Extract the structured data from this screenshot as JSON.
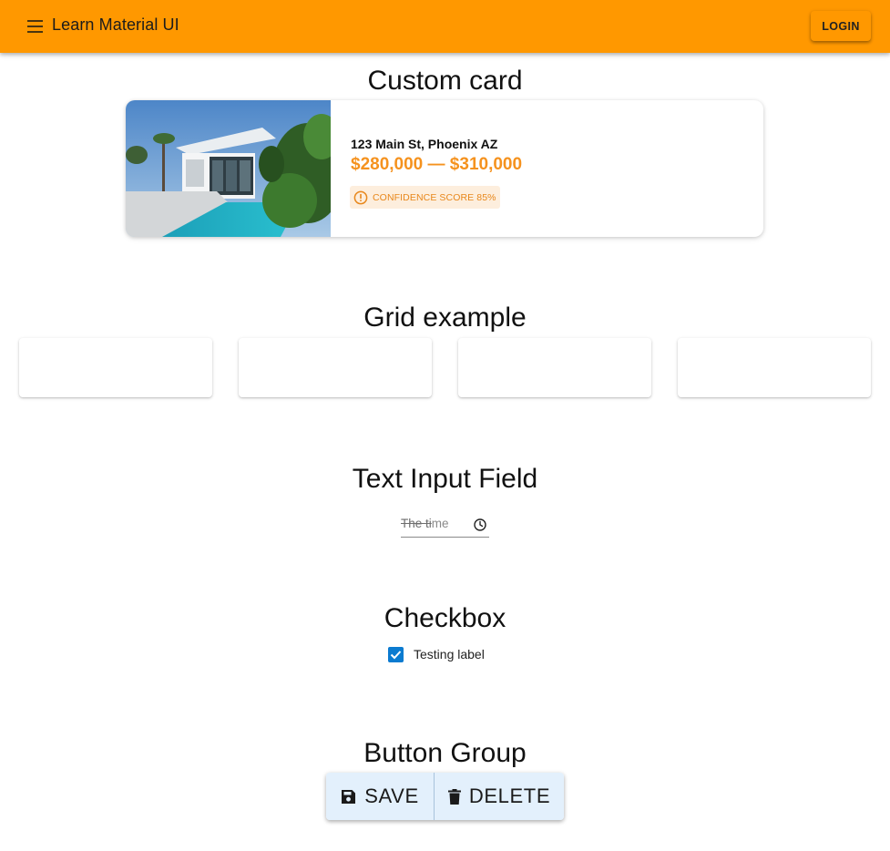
{
  "app_bar": {
    "title": "Learn Material UI",
    "menu_icon": "menu-icon",
    "login_label": "LOGIN",
    "color": "#ff9800"
  },
  "custom_card": {
    "heading": "Custom card",
    "image_icon": "house-photo",
    "address": "123 Main St, Phoenix AZ",
    "price_range": "$280,000 — $310,000",
    "confidence_label": "CONFIDENCE SCORE 85%",
    "confidence_icon": "alert-circle-icon",
    "accent_color": "#f5921e"
  },
  "grid_example": {
    "heading": "Grid example",
    "items": [
      "",
      "",
      "",
      ""
    ]
  },
  "text_input": {
    "heading": "Text Input Field",
    "value_struck": "The ti",
    "value_rest": "me",
    "icon": "clock-icon"
  },
  "checkbox": {
    "heading": "Checkbox",
    "label": "Testing label",
    "checked": true,
    "color": "#0b7bd0"
  },
  "button_group": {
    "heading": "Button Group",
    "save_label": "SAVE",
    "save_icon": "save-icon",
    "delete_label": "DELETE",
    "delete_icon": "trash-icon",
    "background": "#e3f0fc"
  }
}
